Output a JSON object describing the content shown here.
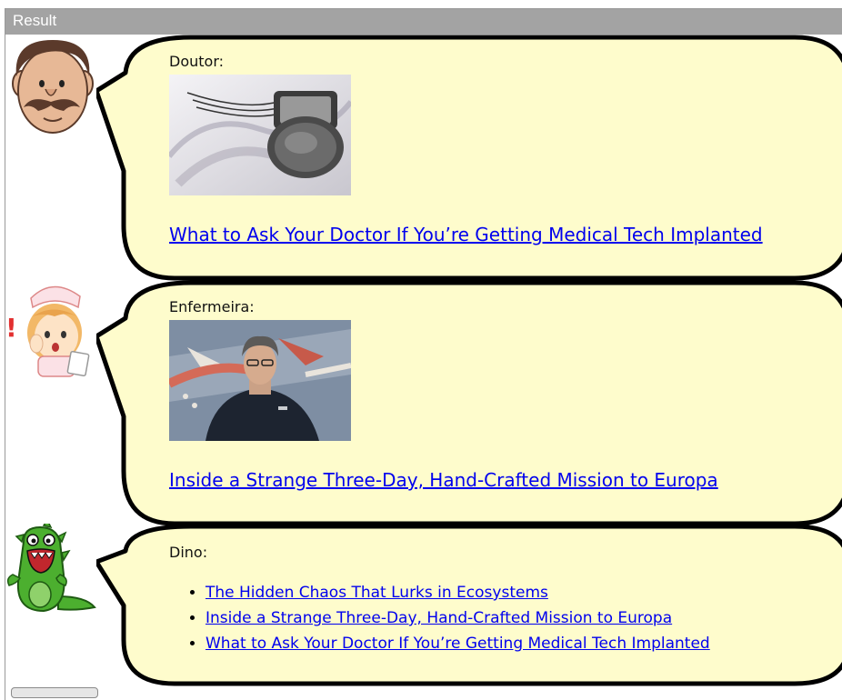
{
  "result_bar": {
    "label": "Result"
  },
  "colors": {
    "bubble_fill": "#fefccc",
    "link": "#0000ee",
    "result_bar": "#a3a3a3"
  },
  "messages": [
    {
      "speaker": "Doutor:",
      "avatar_icon": "doctor-mustache-icon",
      "image_icon": "pacemaker-device-photo",
      "headline": "What to Ask Your Doctor If You’re Getting Medical Tech Implanted"
    },
    {
      "speaker": "Enfermeira:",
      "avatar_icon": "nurse-icon",
      "image_icon": "man-in-dark-jacket-photo",
      "headline": "Inside a Strange Three-Day, Hand-Crafted Mission to Europa"
    },
    {
      "speaker": "Dino:",
      "avatar_icon": "green-dinosaur-icon",
      "links": [
        "The Hidden Chaos That Lurks in Ecosystems",
        "Inside a Strange Three-Day, Hand-Crafted Mission to Europa",
        "What to Ask Your Doctor If You’re Getting Medical Tech Implanted"
      ]
    }
  ]
}
